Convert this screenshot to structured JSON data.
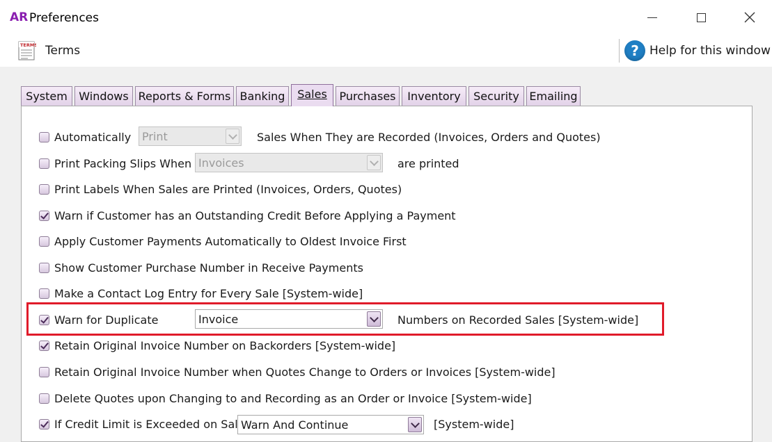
{
  "window": {
    "app_badge": "AR",
    "title": "Preferences"
  },
  "toolbar": {
    "terms_label": "Terms",
    "help_label": "Help for this window",
    "help_glyph": "?"
  },
  "tabs": [
    {
      "label": "System"
    },
    {
      "label": "Windows"
    },
    {
      "label": "Reports & Forms"
    },
    {
      "label": "Banking"
    },
    {
      "label": "Sales",
      "active": true
    },
    {
      "label": "Purchases"
    },
    {
      "label": "Inventory"
    },
    {
      "label": "Security"
    },
    {
      "label": "Emailing"
    }
  ],
  "options": {
    "auto_print": {
      "checked": false,
      "label": "Automatically",
      "select_value": "Print",
      "suffix": "Sales When They are Recorded (Invoices, Orders and Quotes)"
    },
    "packing_slips": {
      "checked": false,
      "label": "Print Packing Slips When",
      "select_value": "Invoices",
      "suffix": "are printed"
    },
    "print_labels": {
      "checked": false,
      "label": "Print Labels When Sales are Printed (Invoices, Orders, Quotes)"
    },
    "warn_credit": {
      "checked": true,
      "label": "Warn if Customer has an Outstanding Credit Before Applying a Payment"
    },
    "apply_payments": {
      "checked": false,
      "label": "Apply Customer Payments Automatically to Oldest Invoice First"
    },
    "show_po": {
      "checked": false,
      "label": "Show Customer Purchase Number in Receive Payments"
    },
    "contact_log": {
      "checked": false,
      "label": "Make a Contact Log Entry for Every Sale [System-wide]"
    },
    "warn_duplicate": {
      "checked": true,
      "label": "Warn for Duplicate",
      "select_value": "Invoice",
      "suffix": "Numbers on Recorded Sales [System-wide]"
    },
    "retain_backorders": {
      "checked": true,
      "label": "Retain Original Invoice Number on Backorders [System-wide]"
    },
    "retain_quotes": {
      "checked": false,
      "label": "Retain Original Invoice Number when Quotes Change to Orders or Invoices [System-wide]"
    },
    "delete_quotes": {
      "checked": false,
      "label": "Delete Quotes upon Changing to and Recording as an Order or Invoice [System-wide]"
    },
    "credit_limit": {
      "checked": true,
      "label": "If Credit Limit is Exceeded on Sale",
      "select_value": "Warn And Continue",
      "suffix": "[System-wide]"
    }
  },
  "colors": {
    "highlight": "#e01b2a",
    "brand": "#8a1fb0",
    "help": "#1f7fc4"
  }
}
